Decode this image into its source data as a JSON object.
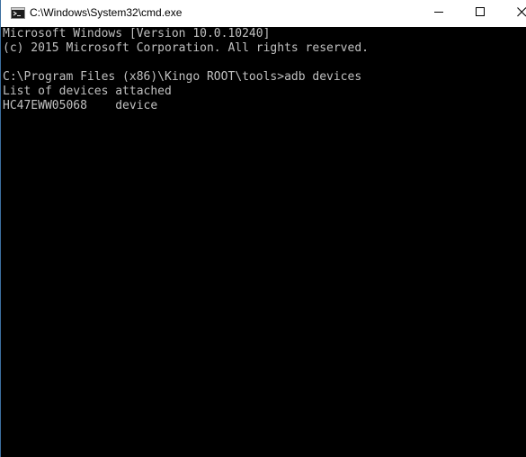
{
  "window": {
    "title": "C:\\Windows\\System32\\cmd.exe",
    "icon": "cmd-icon"
  },
  "title_buttons": {
    "minimize": "minimize-icon",
    "maximize": "maximize-icon",
    "close": "close-icon"
  },
  "colors": {
    "console_background": "#000000",
    "console_text": "#c0c0c0",
    "titlebar_background": "#ffffff"
  },
  "console": {
    "lines": [
      "Microsoft Windows [Version 10.0.10240]",
      "(c) 2015 Microsoft Corporation. All rights reserved.",
      "",
      "C:\\Program Files (x86)\\Kingo ROOT\\tools>adb devices",
      "List of devices attached",
      "HC47EWW05068    device"
    ]
  }
}
